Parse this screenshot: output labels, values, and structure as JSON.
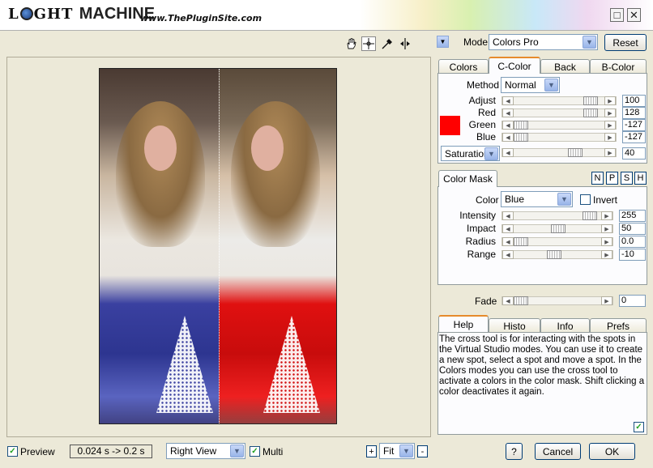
{
  "app": {
    "logo_light_l": "L",
    "logo_light_rest": "GHT",
    "logo_machine": "MACHINE",
    "site": "www.ThePluginSite.com",
    "max_glyph": "□",
    "close_glyph": "✕"
  },
  "toolbar": {
    "mode_label": "Mode",
    "mode_value": "Colors Pro",
    "reset_label": "Reset"
  },
  "tabs_top": [
    "Colors",
    "C-Color",
    "Back",
    "B-Color"
  ],
  "ccolor": {
    "method_label": "Method",
    "method_value": "Normal",
    "swatch_color": "#ff0000",
    "sliders": [
      {
        "label": "Adjust",
        "value": "100",
        "position": 0.9
      },
      {
        "label": "Red",
        "value": "128",
        "position": 0.9
      },
      {
        "label": "Green",
        "value": "-127",
        "position": 0.0
      },
      {
        "label": "Blue",
        "value": "-127",
        "position": 0.0
      }
    ],
    "saturation_label": "Saturation",
    "saturation_value": "40",
    "saturation_position": 0.7
  },
  "mask": {
    "tab_label": "Color Mask",
    "npsh": [
      "N",
      "P",
      "S",
      "H"
    ],
    "color_label": "Color",
    "color_value": "Blue",
    "invert_label": "Invert",
    "sliders": [
      {
        "label": "Intensity",
        "value": "255",
        "position": 0.92
      },
      {
        "label": "Impact",
        "value": "50",
        "position": 0.5
      },
      {
        "label": "Radius",
        "value": "0.0",
        "position": 0.0
      },
      {
        "label": "Range",
        "value": "-10",
        "position": 0.45
      }
    ]
  },
  "fade": {
    "label": "Fade",
    "value": "0",
    "position": 0.0
  },
  "tabs_bottom": [
    "Help",
    "Histo",
    "Info",
    "Prefs"
  ],
  "help_text": "The cross tool is for interacting with the spots in the Virtual Studio modes. You can use it to create a new spot, select a spot and move a spot. In the Colors modes you can use the cross tool to activate a colors in the color mask. Shift clicking a color deactivates it again.",
  "bottom": {
    "preview_label": "Preview",
    "timing": "0.024 s -> 0.2 s",
    "view_value": "Right View",
    "multi_label": "Multi",
    "zoom_plus": "+",
    "zoom_value": "Fit",
    "zoom_minus": "-",
    "help_btn": "?",
    "cancel_label": "Cancel",
    "ok_label": "OK"
  }
}
